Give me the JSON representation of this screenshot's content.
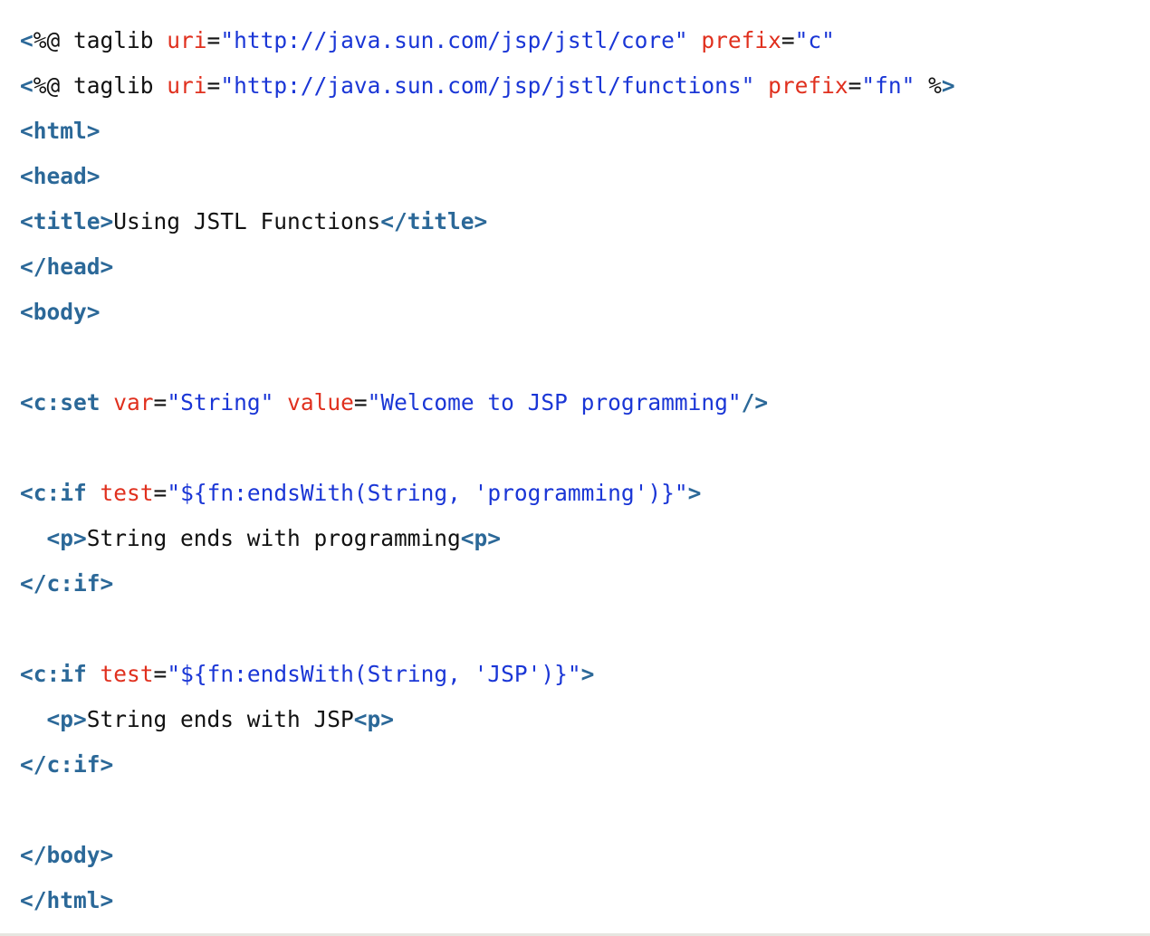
{
  "code_lines": [
    [
      {
        "cls": "tag",
        "text": "<"
      },
      {
        "cls": "plain",
        "text": "%@ taglib "
      },
      {
        "cls": "attr",
        "text": "uri"
      },
      {
        "cls": "plain",
        "text": "="
      },
      {
        "cls": "str",
        "text": "\"http://java.sun.com/jsp/jstl/core\""
      },
      {
        "cls": "plain",
        "text": " "
      },
      {
        "cls": "attr",
        "text": "prefix"
      },
      {
        "cls": "plain",
        "text": "="
      },
      {
        "cls": "str",
        "text": "\"c\""
      }
    ],
    [
      {
        "cls": "tag",
        "text": "<"
      },
      {
        "cls": "plain",
        "text": "%@ taglib "
      },
      {
        "cls": "attr",
        "text": "uri"
      },
      {
        "cls": "plain",
        "text": "="
      },
      {
        "cls": "str",
        "text": "\"http://java.sun.com/jsp/jstl/functions\""
      },
      {
        "cls": "plain",
        "text": " "
      },
      {
        "cls": "attr",
        "text": "prefix"
      },
      {
        "cls": "plain",
        "text": "="
      },
      {
        "cls": "str",
        "text": "\"fn\""
      },
      {
        "cls": "plain",
        "text": " %"
      },
      {
        "cls": "tag",
        "text": ">"
      }
    ],
    [
      {
        "cls": "tag",
        "text": "<html>"
      }
    ],
    [
      {
        "cls": "tag",
        "text": "<head>"
      }
    ],
    [
      {
        "cls": "tag",
        "text": "<title>"
      },
      {
        "cls": "plain",
        "text": "Using JSTL Functions"
      },
      {
        "cls": "tag",
        "text": "</title>"
      }
    ],
    [
      {
        "cls": "tag",
        "text": "</head>"
      }
    ],
    [
      {
        "cls": "tag",
        "text": "<body>"
      }
    ],
    [],
    [
      {
        "cls": "tag",
        "text": "<c:set"
      },
      {
        "cls": "plain",
        "text": " "
      },
      {
        "cls": "attr",
        "text": "var"
      },
      {
        "cls": "plain",
        "text": "="
      },
      {
        "cls": "str",
        "text": "\"String\""
      },
      {
        "cls": "plain",
        "text": " "
      },
      {
        "cls": "attr",
        "text": "value"
      },
      {
        "cls": "plain",
        "text": "="
      },
      {
        "cls": "str",
        "text": "\"Welcome to JSP programming\""
      },
      {
        "cls": "tag",
        "text": "/>"
      }
    ],
    [],
    [
      {
        "cls": "tag",
        "text": "<c:if"
      },
      {
        "cls": "plain",
        "text": " "
      },
      {
        "cls": "attr",
        "text": "test"
      },
      {
        "cls": "plain",
        "text": "="
      },
      {
        "cls": "str",
        "text": "\"${fn:endsWith(String, 'programming')}\""
      },
      {
        "cls": "tag",
        "text": ">"
      }
    ],
    [
      {
        "cls": "plain",
        "text": "  "
      },
      {
        "cls": "tag",
        "text": "<p>"
      },
      {
        "cls": "plain",
        "text": "String ends with programming"
      },
      {
        "cls": "tag",
        "text": "<p>"
      }
    ],
    [
      {
        "cls": "tag",
        "text": "</c:if>"
      }
    ],
    [],
    [
      {
        "cls": "tag",
        "text": "<c:if"
      },
      {
        "cls": "plain",
        "text": " "
      },
      {
        "cls": "attr",
        "text": "test"
      },
      {
        "cls": "plain",
        "text": "="
      },
      {
        "cls": "str",
        "text": "\"${fn:endsWith(String, 'JSP')}\""
      },
      {
        "cls": "tag",
        "text": ">"
      }
    ],
    [
      {
        "cls": "plain",
        "text": "  "
      },
      {
        "cls": "tag",
        "text": "<p>"
      },
      {
        "cls": "plain",
        "text": "String ends with JSP"
      },
      {
        "cls": "tag",
        "text": "<p>"
      }
    ],
    [
      {
        "cls": "tag",
        "text": "</c:if>"
      }
    ],
    [],
    [
      {
        "cls": "tag",
        "text": "</body>"
      }
    ],
    [
      {
        "cls": "tag",
        "text": "</html>"
      }
    ]
  ]
}
